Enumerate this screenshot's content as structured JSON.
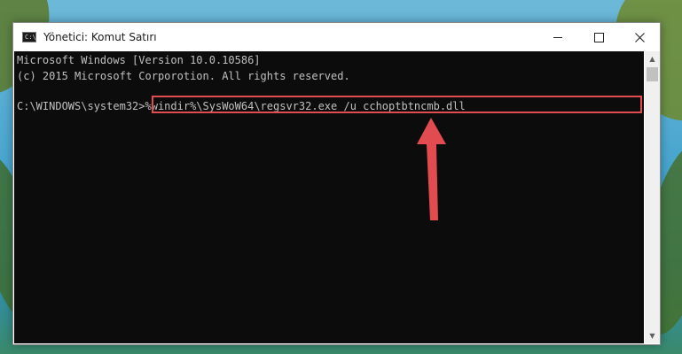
{
  "window": {
    "title": "Yönetici: Komut Satırı",
    "icon_text": "C:\\"
  },
  "console": {
    "lines": [
      "Microsoft Windows [Version 10.0.10586]",
      "(c) 2015 Microsoft Corporotion. All rights reserved."
    ],
    "prompt": "C:\\WINDOWS\\system32>",
    "command": "%windir%\\SysWoW64\\regsvr32.exe /u cchoptbtncmb.dll"
  },
  "controls": {
    "minimize": "minimize-icon",
    "maximize": "maximize-icon",
    "close": "close-icon"
  },
  "colors": {
    "console_bg": "#0c0c0c",
    "console_text": "#c0c0c0",
    "highlight": "#e24b50"
  }
}
